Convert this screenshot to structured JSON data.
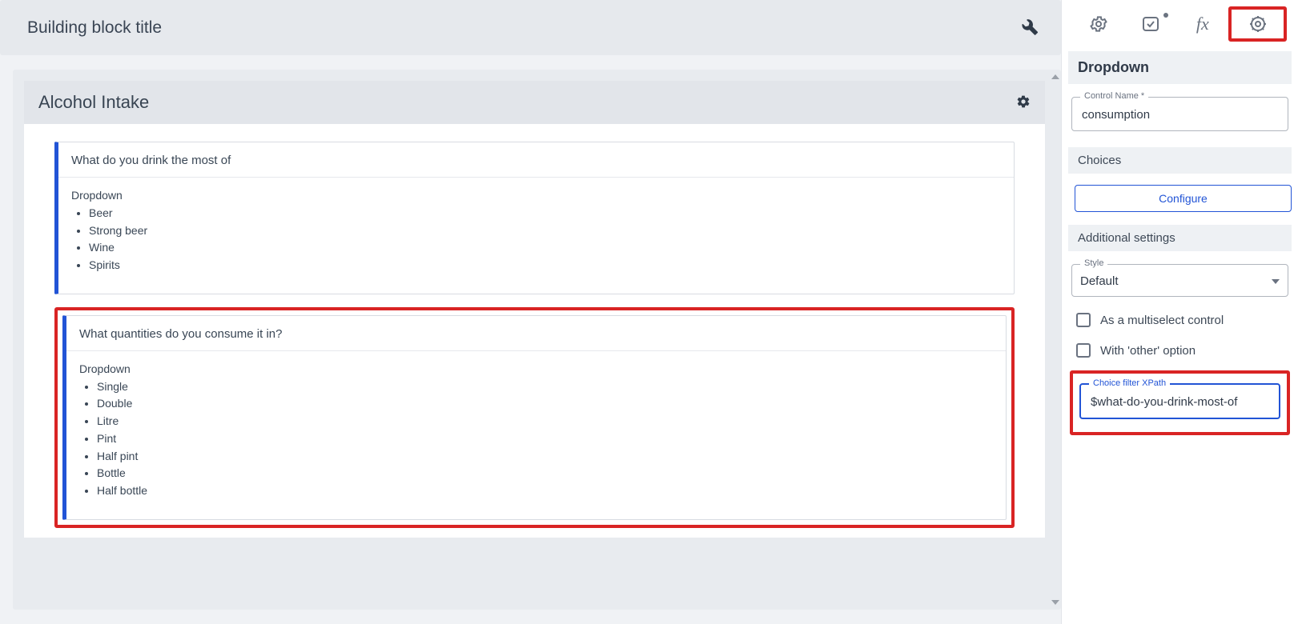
{
  "titlebar": {
    "title": "Building block title"
  },
  "section": {
    "title": "Alcohol Intake"
  },
  "questions": [
    {
      "title": "What do you drink the most of",
      "type_label": "Dropdown",
      "options": [
        "Beer",
        "Strong beer",
        "Wine",
        "Spirits"
      ]
    },
    {
      "title": "What quantities do you consume it in?",
      "type_label": "Dropdown",
      "options": [
        "Single",
        "Double",
        "Litre",
        "Pint",
        "Half pint",
        "Bottle",
        "Half bottle"
      ]
    }
  ],
  "sidebar": {
    "panel_title": "Dropdown",
    "control_name": {
      "label": "Control Name *",
      "value": "consumption"
    },
    "choices": {
      "header": "Choices",
      "configure_label": "Configure"
    },
    "additional": {
      "header": "Additional settings",
      "style": {
        "label": "Style",
        "value": "Default"
      },
      "multiselect_label": "As a multiselect control",
      "other_label": "With 'other' option",
      "xpath": {
        "label": "Choice filter XPath",
        "value": "$what-do-you-drink-most-of"
      }
    }
  }
}
